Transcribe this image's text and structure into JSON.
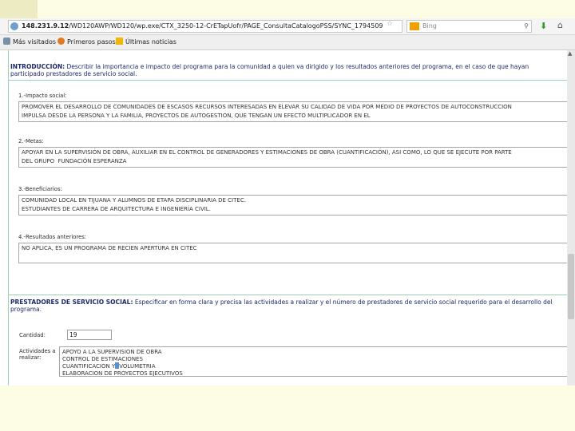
{
  "browser": {
    "url_ip": "148.231.9.12",
    "url_path": "/WD120AWP/WD120/wp.exe/CTX_3250-12-CrETapUofr/PAGE_ConsultaCatalogoPSS/SYNC_1794509",
    "search_placeholder": "Bing",
    "bookmarks": [
      {
        "label": "Más visitados",
        "icon": "gear-icon"
      },
      {
        "label": "Primeros pasos",
        "icon": "firefox-icon"
      },
      {
        "label": "Últimas noticias",
        "icon": "rss-icon"
      }
    ]
  },
  "intro": {
    "heading": "INTRODUCCIÓN:",
    "line1": "Describir la importancia e impacto del programa para la comunidad a quien va dirigido y los resultados anteriores del programa, en el caso de que hayan",
    "line2": "participado prestadores de servicio social."
  },
  "sections": [
    {
      "label": "1.-Impacto social:",
      "lines": [
        "PROMOVER EL DESARROLLO DE COMUNIDADES DE ESCASOS RECURSOS INTERESADAS EN ELEVAR SU CALIDAD DE VIDA POR MEDIO DE PROYECTOS DE AUTOCONSTRUCCION",
        "IMPULSA DESDE LA PERSONA Y LA FAMILIA, PROYECTOS DE AUTOGESTION, QUE TENGAN UN EFECTO MULTIPLICADOR EN EL"
      ]
    },
    {
      "label": "2.-Metas:",
      "lines": [
        "APOYAR EN LA SUPERVISIÓN DE OBRA, AUXILIAR EN EL CONTROL DE GENERADORES Y ESTIMACIONES DE OBRA (CUANTIFICACIÓN), ASI COMO, LO QUE SE EJECUTE POR PARTE",
        "DEL GRUPO  FUNDACIÓN ESPERANZA"
      ]
    },
    {
      "label": "3.-Beneficiarios:",
      "lines": [
        "COMUNIDAD LOCAL EN TIJUANA Y ALUMNOS DE ETAPA DISCIPLINARIA DE CITEC.",
        "ESTUDIANTES DE CARRERA DE ARQUITECTURA E INGENIERÍA CIVIL."
      ]
    },
    {
      "label": "4.-Resultados anteriores:",
      "lines": [
        "NO APLICA, ES UN PROGRAMA DE RECIEN APERTURA EN CITEC"
      ]
    }
  ],
  "prestadores": {
    "heading": "PRESTADORES DE SERVICIO SOCIAL:",
    "line1": "Especificar en forma clara y precisa las actividades a realizar y el número de prestadores de servicio social requerido para el desarrollo del",
    "line2": "programa.",
    "cantidad_label": "Cantidad:",
    "cantidad_value": "19",
    "actividades_label1": "Actividades a",
    "actividades_label2": "realizar:",
    "actividades": [
      "APOYO A LA SUPERVISION DE OBRA",
      "CONTROL DE ESTIMACIONES",
      "CUANTIFICACION Y",
      "VOLUMETRIA",
      "ELABORACION DE PROYECTOS EJECUTIVOS"
    ]
  }
}
